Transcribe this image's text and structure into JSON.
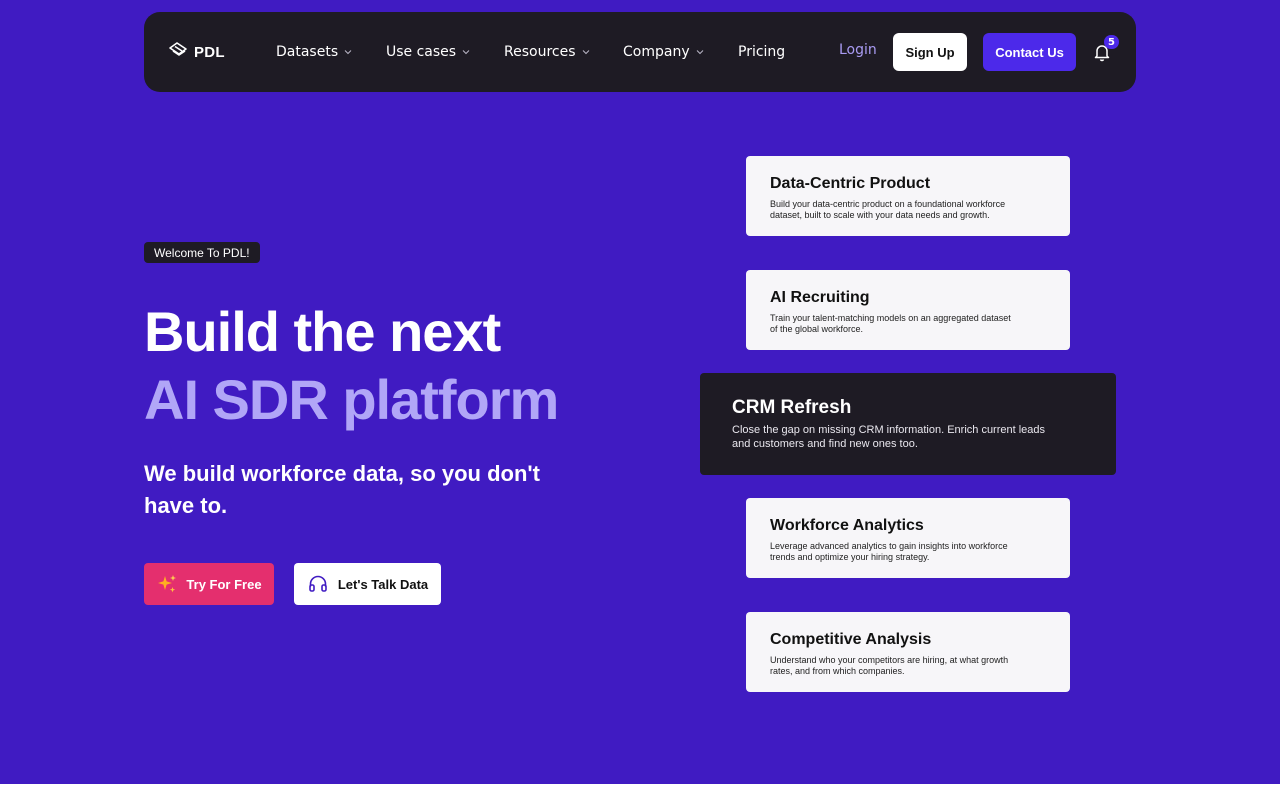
{
  "brand": {
    "name": "PDL"
  },
  "nav": {
    "items": [
      {
        "label": "Datasets",
        "dropdown": true
      },
      {
        "label": "Use cases",
        "dropdown": true
      },
      {
        "label": "Resources",
        "dropdown": true
      },
      {
        "label": "Company",
        "dropdown": true
      },
      {
        "label": "Pricing",
        "dropdown": false
      }
    ],
    "login": "Login",
    "signup": "Sign Up",
    "contact": "Contact Us",
    "notifications_count": "5"
  },
  "hero": {
    "badge": "Welcome To PDL!",
    "headline_line1": "Build the next",
    "headline_line2": "AI SDR platform",
    "subhead": "We build workforce data, so you don't have to.",
    "cta_primary": "Try For Free",
    "cta_secondary": "Let's Talk Data"
  },
  "cards": [
    {
      "title": "Data-Centric Product",
      "desc": "Build your data-centric product on a foundational workforce dataset, built to scale with your data needs and growth.",
      "active": false
    },
    {
      "title": "AI Recruiting",
      "desc": "Train your talent-matching models on an aggregated dataset of the global workforce.",
      "active": false
    },
    {
      "title": "CRM Refresh",
      "desc": "Close the gap on missing CRM information. Enrich current leads and customers and find new ones too.",
      "active": true
    },
    {
      "title": "Workforce Analytics",
      "desc": "Leverage advanced analytics to gain insights into workforce trends and optimize your hiring strategy.",
      "active": false
    },
    {
      "title": "Competitive Analysis",
      "desc": "Understand who your competitors are hiring, at what growth rates, and from which companies.",
      "active": false
    }
  ],
  "colors": {
    "hero_bg": "#401bc2",
    "nav_bg": "#1e1b24",
    "accent": "#4c29ea",
    "headline_highlight": "#b1a6f7",
    "cta_primary": "#e42f6e",
    "login": "#a99bf2"
  },
  "icons": {
    "logo": "pdl-logo-icon",
    "dropdown": "chevron-down-icon",
    "notifications": "bell-icon",
    "cta_primary": "sparkles-icon",
    "cta_secondary": "headset-icon"
  }
}
